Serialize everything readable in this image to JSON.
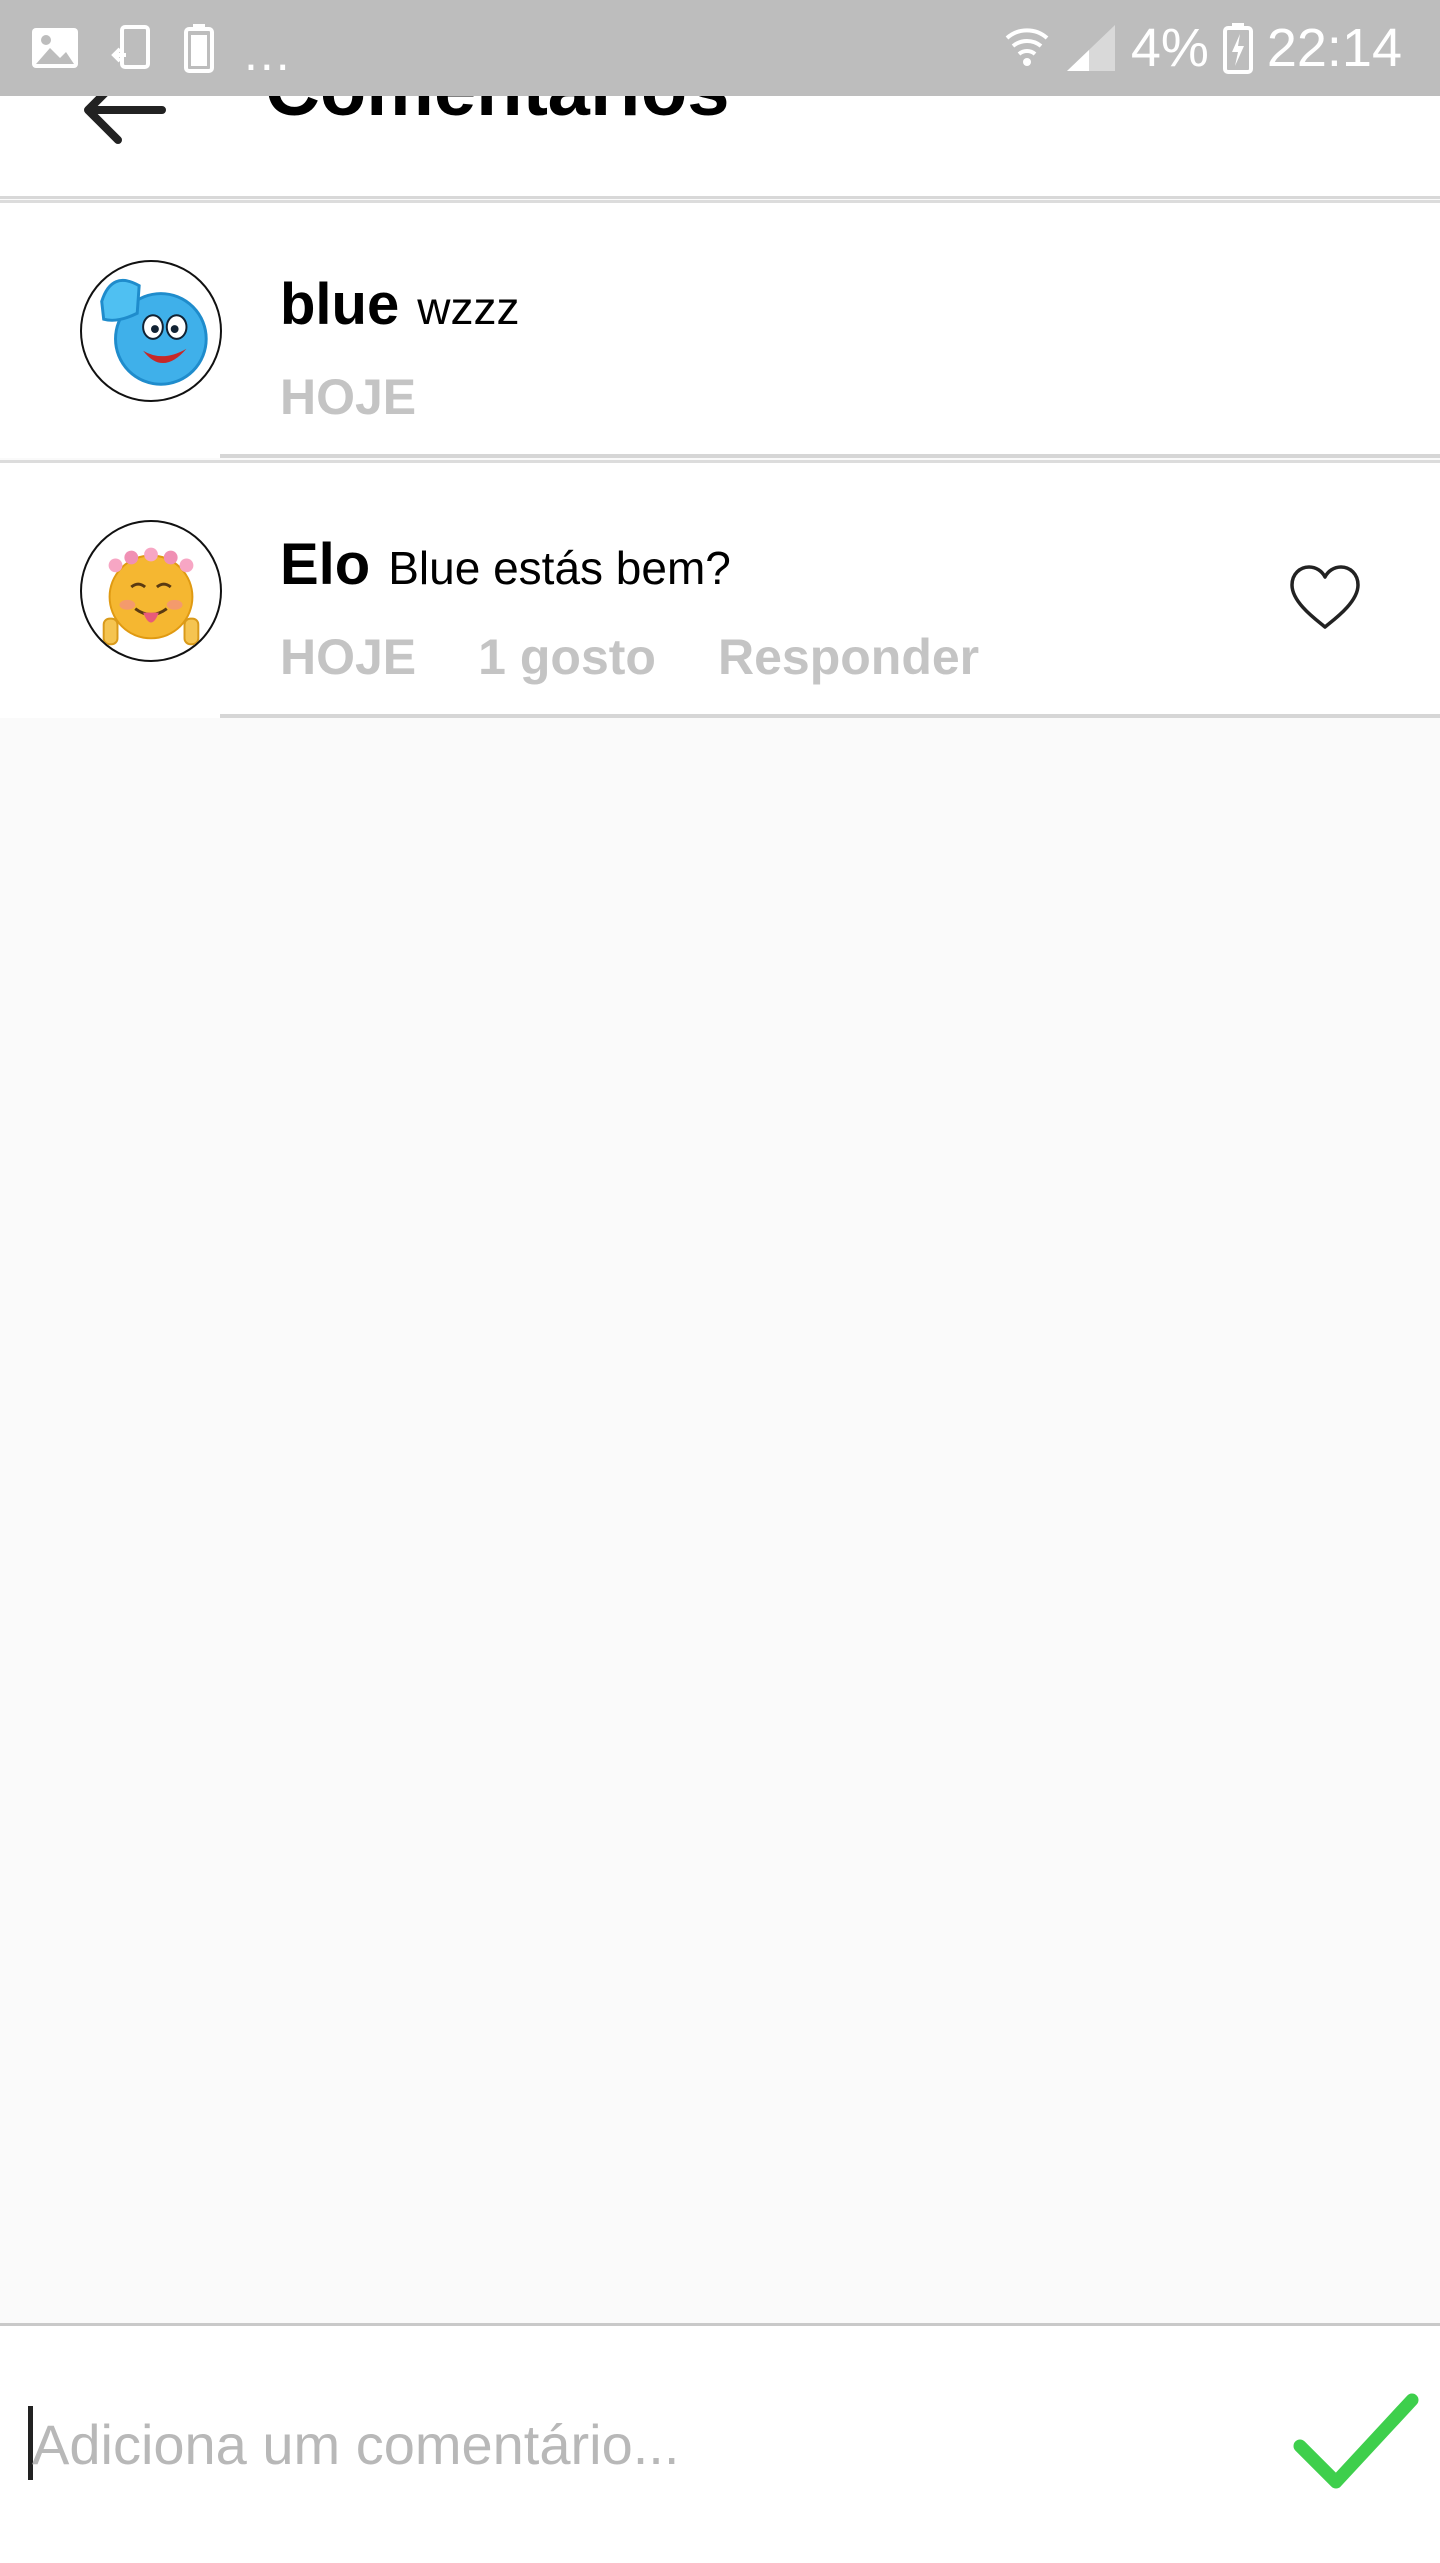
{
  "status_bar": {
    "battery_percent": "4%",
    "time": "22:14",
    "overflow": "...",
    "left_icons": [
      "gallery-icon",
      "screen-cast-icon",
      "battery-icon"
    ],
    "right_icons": [
      "wifi-icon",
      "signal-icon",
      "charging-battery-icon"
    ]
  },
  "header": {
    "title": "Comentários",
    "back_icon": "back-arrow-icon"
  },
  "comments": [
    {
      "username": "blue",
      "text": "wzzz",
      "time": "HOJE",
      "avatar": "blue-thumbs-up-smiley"
    },
    {
      "username": "Elo",
      "text": "Blue estás bem?",
      "time": "HOJE",
      "likes": "1 gosto",
      "reply": "Responder",
      "avatar": "flower-crown-emoji",
      "like_icon": "heart-outline-icon"
    }
  ],
  "composer": {
    "placeholder": "Adiciona um comentário...",
    "value": "",
    "send_icon": "checkmark-icon"
  },
  "colors": {
    "status_bar": "#bdbdbd",
    "meta_text": "#c4c4c4",
    "send_check": "#3ecf4c",
    "background": "#fafafa"
  }
}
